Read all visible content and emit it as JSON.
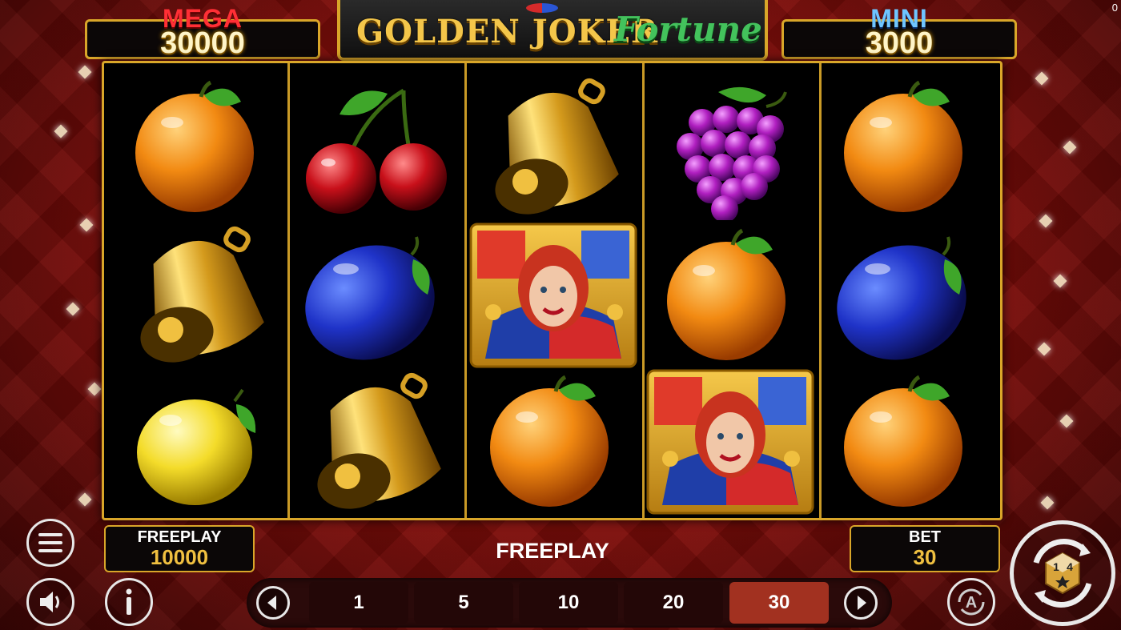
{
  "jackpots": {
    "mega": {
      "label": "MEGA",
      "value": "30000"
    },
    "mini": {
      "label": "MINI",
      "value": "3000"
    }
  },
  "logo": {
    "word1": "GOLDEN JOKER",
    "word2": "Fortune"
  },
  "corner_counter": "0",
  "reels": [
    [
      "orange",
      "bell",
      "lemon"
    ],
    [
      "cherries",
      "plum",
      "bell"
    ],
    [
      "bell",
      "joker-wild",
      "orange"
    ],
    [
      "grapes",
      "orange",
      "joker-wild"
    ],
    [
      "orange",
      "plum",
      "orange"
    ]
  ],
  "balance": {
    "label": "FREEPLAY",
    "value": "10000"
  },
  "status": {
    "text": "FREEPLAY"
  },
  "bet": {
    "label": "BET",
    "value": "30"
  },
  "bet_options": [
    "1",
    "5",
    "10",
    "20",
    "30"
  ],
  "bet_selected": "30",
  "icons": {
    "menu": "hamburger-menu-icon",
    "sound": "speaker-icon",
    "info": "info-icon",
    "autoplay": "autoplay-icon",
    "spin": "spin-icon",
    "prev": "arrow-left-icon",
    "next": "arrow-right-icon"
  },
  "colors": {
    "gold_frame": "#d9a629",
    "mega_red": "#ff2f35",
    "mini_blue": "#6fc5ff",
    "active_bet": "#a23120"
  }
}
